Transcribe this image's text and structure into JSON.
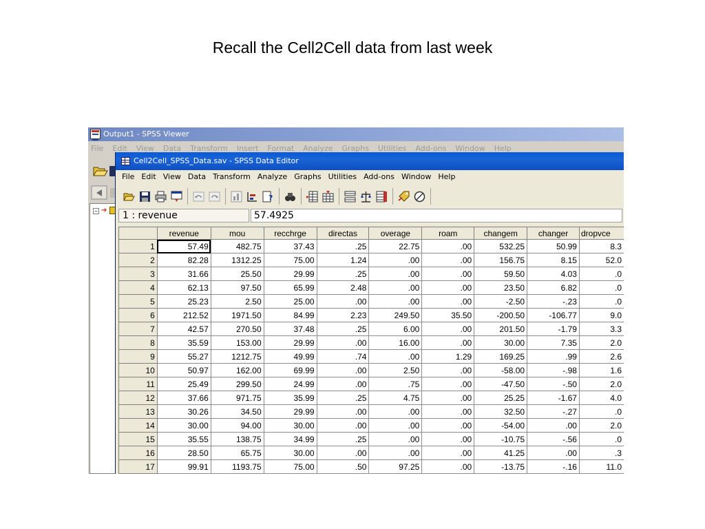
{
  "slide": {
    "title": "Recall the Cell2Cell data from last week"
  },
  "viewer": {
    "title": "Output1 - SPSS Viewer",
    "menu": [
      "File",
      "Edit",
      "View",
      "Data",
      "Transform",
      "Insert",
      "Format",
      "Analyze",
      "Graphs",
      "Utilities",
      "Add-ons",
      "Window",
      "Help"
    ],
    "tree_expander": "−"
  },
  "editor": {
    "title": "Cell2Cell_SPSS_Data.sav - SPSS Data Editor",
    "menu": [
      "File",
      "Edit",
      "View",
      "Data",
      "Transform",
      "Analyze",
      "Graphs",
      "Utilities",
      "Add-ons",
      "Window",
      "Help"
    ],
    "toolbar_icons": [
      "open-folder-icon",
      "save-disk-icon",
      "print-icon",
      "dialog-recall-icon",
      "undo-icon",
      "redo-icon",
      "goto-chart-icon",
      "goto-case-icon",
      "variables-icon",
      "find-icon",
      "insert-case-icon",
      "insert-variable-icon",
      "split-file-icon",
      "weight-cases-icon",
      "select-cases-icon",
      "value-labels-icon",
      "use-sets-icon"
    ],
    "cell_ref": "1 : revenue",
    "cell_value": "57.4925"
  },
  "grid": {
    "columns": [
      "revenue",
      "mou",
      "recchrge",
      "directas",
      "overage",
      "roam",
      "changem",
      "changer",
      "dropvce"
    ],
    "rows": [
      {
        "n": "1",
        "cells": [
          "57.49",
          "482.75",
          "37.43",
          ".25",
          "22.75",
          ".00",
          "532.25",
          "50.99",
          "8.3"
        ]
      },
      {
        "n": "2",
        "cells": [
          "82.28",
          "1312.25",
          "75.00",
          "1.24",
          ".00",
          ".00",
          "156.75",
          "8.15",
          "52.0"
        ]
      },
      {
        "n": "3",
        "cells": [
          "31.66",
          "25.50",
          "29.99",
          ".25",
          ".00",
          ".00",
          "59.50",
          "4.03",
          ".0"
        ]
      },
      {
        "n": "4",
        "cells": [
          "62.13",
          "97.50",
          "65.99",
          "2.48",
          ".00",
          ".00",
          "23.50",
          "6.82",
          ".0"
        ]
      },
      {
        "n": "5",
        "cells": [
          "25.23",
          "2.50",
          "25.00",
          ".00",
          ".00",
          ".00",
          "-2.50",
          "-.23",
          ".0"
        ]
      },
      {
        "n": "6",
        "cells": [
          "212.52",
          "1971.50",
          "84.99",
          "2.23",
          "249.50",
          "35.50",
          "-200.50",
          "-106.77",
          "9.0"
        ]
      },
      {
        "n": "7",
        "cells": [
          "42.57",
          "270.50",
          "37.48",
          ".25",
          "6.00",
          ".00",
          "201.50",
          "-1.79",
          "3.3"
        ]
      },
      {
        "n": "8",
        "cells": [
          "35.59",
          "153.00",
          "29.99",
          ".00",
          "16.00",
          ".00",
          "30.00",
          "7.35",
          "2.0"
        ]
      },
      {
        "n": "9",
        "cells": [
          "55.27",
          "1212.75",
          "49.99",
          ".74",
          ".00",
          "1.29",
          "169.25",
          ".99",
          "2.6"
        ]
      },
      {
        "n": "10",
        "cells": [
          "50.97",
          "162.00",
          "69.99",
          ".00",
          "2.50",
          ".00",
          "-58.00",
          "-.98",
          "1.6"
        ]
      },
      {
        "n": "11",
        "cells": [
          "25.49",
          "299.50",
          "24.99",
          ".00",
          ".75",
          ".00",
          "-47.50",
          "-.50",
          "2.0"
        ]
      },
      {
        "n": "12",
        "cells": [
          "37.66",
          "971.75",
          "35.99",
          ".25",
          "4.75",
          ".00",
          "25.25",
          "-1.67",
          "4.0"
        ]
      },
      {
        "n": "13",
        "cells": [
          "30.26",
          "34.50",
          "29.99",
          ".00",
          ".00",
          ".00",
          "32.50",
          "-.27",
          ".0"
        ]
      },
      {
        "n": "14",
        "cells": [
          "30.00",
          "94.00",
          "30.00",
          ".00",
          ".00",
          ".00",
          "-54.00",
          ".00",
          "2.0"
        ]
      },
      {
        "n": "15",
        "cells": [
          "35.55",
          "138.75",
          "34.99",
          ".25",
          ".00",
          ".00",
          "-10.75",
          "-.56",
          ".0"
        ]
      },
      {
        "n": "16",
        "cells": [
          "28.50",
          "65.75",
          "30.00",
          ".00",
          ".00",
          ".00",
          "41.25",
          ".00",
          ".3"
        ]
      },
      {
        "n": "17",
        "cells": [
          "99.91",
          "1193.75",
          "75.00",
          ".50",
          "97.25",
          ".00",
          "-13.75",
          "-.16",
          "11.0"
        ]
      }
    ]
  }
}
